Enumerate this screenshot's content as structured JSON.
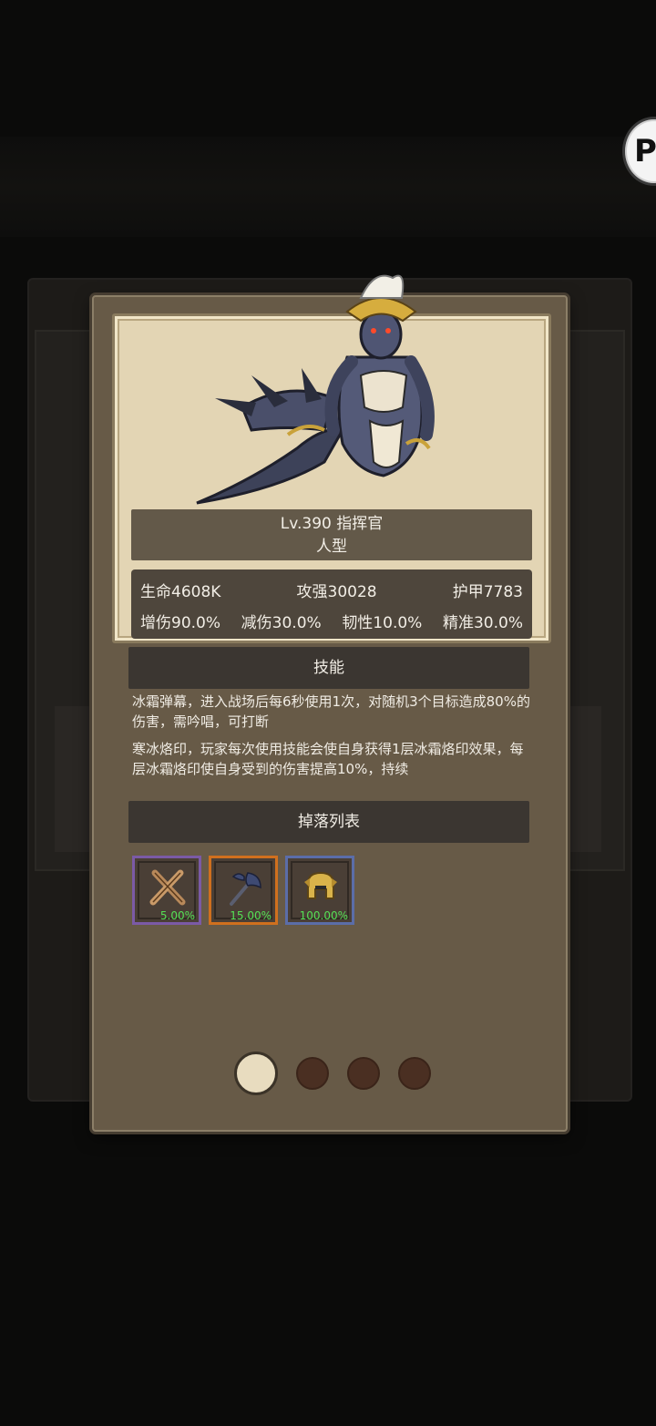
{
  "monster": {
    "name_line": "Lv.390 指挥官",
    "type": "人型",
    "stats_row1": [
      "生命4608K",
      "攻强30028",
      "护甲7783"
    ],
    "stats_row2": [
      "增伤90.0%",
      "减伤30.0%",
      "韧性10.0%",
      "精准30.0%"
    ]
  },
  "skills": {
    "header": "技能",
    "items": [
      "冰霜弹幕，进入战场后每6秒使用1次，对随机3个目标造成80%的伤害，需吟唱，可打断",
      "寒冰烙印，玩家每次使用技能会使自身获得1层冰霜烙印效果，每层冰霜烙印使自身受到的伤害提高10%，持续"
    ]
  },
  "drops": {
    "header": "掉落列表",
    "items": [
      {
        "icon": "crossed-sticks-icon",
        "rate": "5.00%",
        "rarity_color": "#7b5aa6"
      },
      {
        "icon": "axe-icon",
        "rate": "15.00%",
        "rarity_color": "#d0701e"
      },
      {
        "icon": "helmet-icon",
        "rate": "100.00%",
        "rarity_color": "#5b6da8"
      }
    ]
  },
  "pager": {
    "count": 4,
    "active": 0
  }
}
